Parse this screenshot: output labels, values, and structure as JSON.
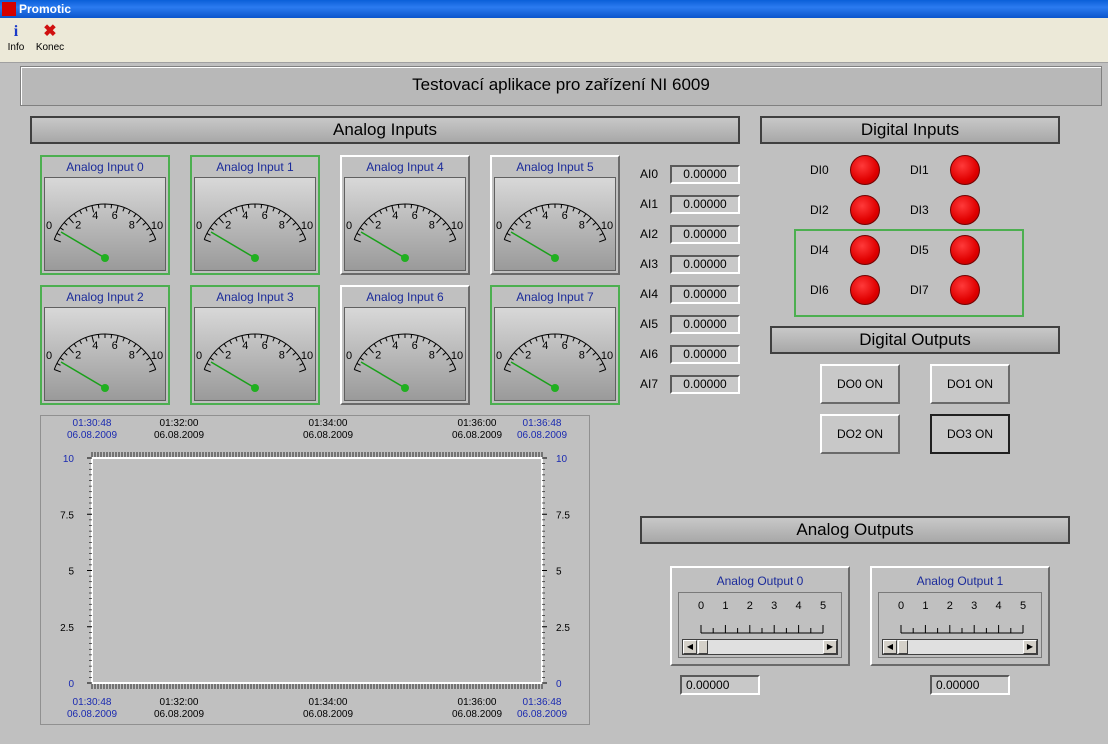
{
  "window": {
    "title": "Promotic"
  },
  "toolbar": {
    "info": {
      "label": "Info",
      "icon": "info-icon"
    },
    "konec": {
      "label": "Konec",
      "icon": "close-icon"
    }
  },
  "app_title": "Testovací aplikace pro zařízení NI 6009",
  "analog_inputs": {
    "header": "Analog Inputs",
    "scale_labels": [
      "0",
      "2",
      "4",
      "6",
      "8",
      "10"
    ],
    "gauges": [
      {
        "label": "Analog Input 0",
        "active": true
      },
      {
        "label": "Analog Input 1",
        "active": true
      },
      {
        "label": "Analog Input 4",
        "active": false
      },
      {
        "label": "Analog Input 5",
        "active": false
      },
      {
        "label": "Analog Input 2",
        "active": true
      },
      {
        "label": "Analog Input 3",
        "active": true
      },
      {
        "label": "Analog Input 6",
        "active": false
      },
      {
        "label": "Analog Input 7",
        "active": true
      }
    ],
    "values": [
      {
        "label": "AI0",
        "value": "0.00000"
      },
      {
        "label": "AI1",
        "value": "0.00000"
      },
      {
        "label": "AI2",
        "value": "0.00000"
      },
      {
        "label": "AI3",
        "value": "0.00000"
      },
      {
        "label": "AI4",
        "value": "0.00000"
      },
      {
        "label": "AI5",
        "value": "0.00000"
      },
      {
        "label": "AI6",
        "value": "0.00000"
      },
      {
        "label": "AI7",
        "value": "0.00000"
      }
    ]
  },
  "digital_inputs": {
    "header": "Digital Inputs",
    "items": [
      "DI0",
      "DI1",
      "DI2",
      "DI3",
      "DI4",
      "DI5",
      "DI6",
      "DI7"
    ],
    "led_color": "#e00000"
  },
  "digital_outputs": {
    "header": "Digital Outputs",
    "buttons": [
      "DO0 ON",
      "DO1 ON",
      "DO2 ON",
      "DO3 ON"
    ]
  },
  "analog_outputs": {
    "header": "Analog Outputs",
    "channels": [
      {
        "label": "Analog Output 0",
        "value": "0.00000"
      },
      {
        "label": "Analog Output 1",
        "value": "0.00000"
      }
    ],
    "scale_labels": [
      "0",
      "1",
      "2",
      "3",
      "4",
      "5"
    ]
  },
  "trend": {
    "time_labels_top": [
      {
        "time": "01:30:48",
        "date": "06.08.2009",
        "edge": true
      },
      {
        "time": "01:32:00",
        "date": "06.08.2009",
        "edge": false
      },
      {
        "time": "01:34:00",
        "date": "06.08.2009",
        "edge": false
      },
      {
        "time": "01:36:00",
        "date": "06.08.2009",
        "edge": false
      },
      {
        "time": "01:36:48",
        "date": "06.08.2009",
        "edge": true
      }
    ],
    "y_ticks": [
      "10",
      "7.5",
      "5",
      "2.5",
      "0"
    ],
    "edge_color": "#1a2ab0"
  }
}
